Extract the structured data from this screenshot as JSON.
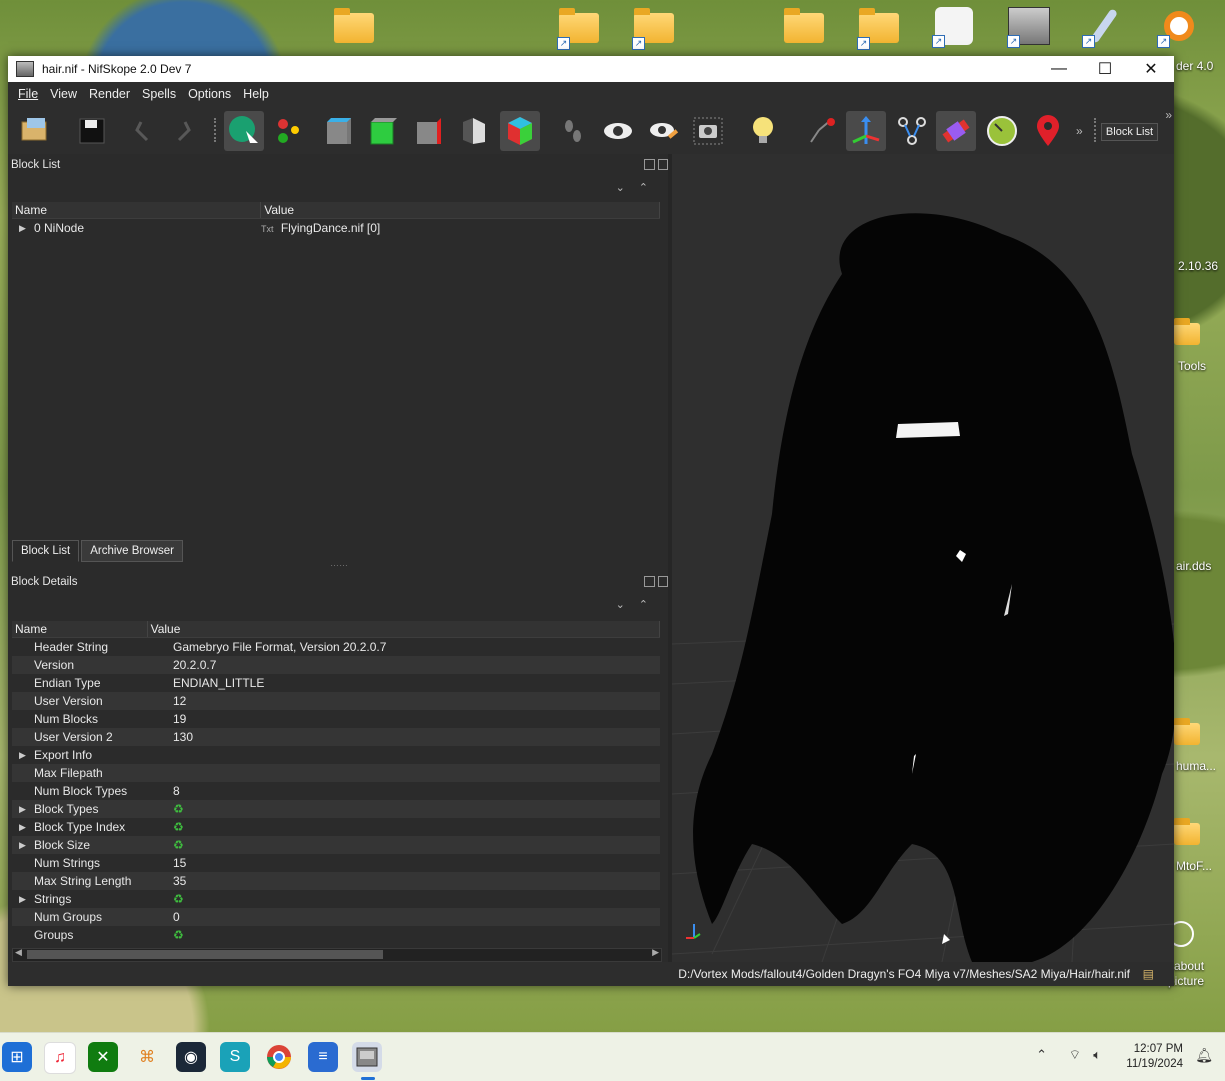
{
  "desktop": {
    "labels": [
      "der 4.0",
      "2.10.36",
      "Tools",
      "air.dds",
      "huma...",
      "MtoF...",
      "about\npicture"
    ]
  },
  "window": {
    "title": "hair.nif - NifSkope 2.0 Dev 7",
    "controls": {
      "minimize": "—",
      "maximize": "☐",
      "close": "✕"
    }
  },
  "menu": [
    "File",
    "View",
    "Render",
    "Spells",
    "Options",
    "Help"
  ],
  "toolbar": {
    "overflow": "»",
    "blocklist_button": "Block List"
  },
  "block_list": {
    "title": "Block List",
    "columns": [
      "Name",
      "Value"
    ],
    "rows": [
      {
        "name": "0 NiNode",
        "value": "FlyingDance.nif [0]"
      }
    ],
    "tabs": [
      "Block List",
      "Archive Browser"
    ]
  },
  "block_details": {
    "title": "Block Details",
    "columns": [
      "Name",
      "Value"
    ],
    "rows": [
      {
        "name": "Header String",
        "value": "Gamebryo File Format, Version 20.2.0.7",
        "expandable": false
      },
      {
        "name": "Version",
        "value": "20.2.0.7",
        "expandable": false
      },
      {
        "name": "Endian Type",
        "value": "ENDIAN_LITTLE",
        "expandable": false
      },
      {
        "name": "User Version",
        "value": "12",
        "expandable": false
      },
      {
        "name": "Num Blocks",
        "value": "19",
        "expandable": false
      },
      {
        "name": "User Version 2",
        "value": "130",
        "expandable": false
      },
      {
        "name": "Export Info",
        "value": "",
        "expandable": true
      },
      {
        "name": "Max Filepath",
        "value": "",
        "expandable": false
      },
      {
        "name": "Num Block Types",
        "value": "8",
        "expandable": false
      },
      {
        "name": "Block Types",
        "value": "♻",
        "expandable": true
      },
      {
        "name": "Block Type Index",
        "value": "♻",
        "expandable": true
      },
      {
        "name": "Block Size",
        "value": "♻",
        "expandable": true
      },
      {
        "name": "Num Strings",
        "value": "15",
        "expandable": false
      },
      {
        "name": "Max String Length",
        "value": "35",
        "expandable": false
      },
      {
        "name": "Strings",
        "value": "♻",
        "expandable": true
      },
      {
        "name": "Num Groups",
        "value": "0",
        "expandable": false
      },
      {
        "name": "Groups",
        "value": "♻",
        "expandable": false
      }
    ]
  },
  "status": {
    "path": "D:/Vortex Mods/fallout4/Golden Dragyn's FO4 Miya v7/Meshes/SA2 Miya/Hair/hair.nif"
  },
  "taskbar": {
    "time": "12:07 PM",
    "date": "11/19/2024"
  },
  "colors": {
    "window_bg": "#2b2b2b",
    "viewport_bg": "#2f2f2f",
    "accent": "#3fbf3f"
  }
}
